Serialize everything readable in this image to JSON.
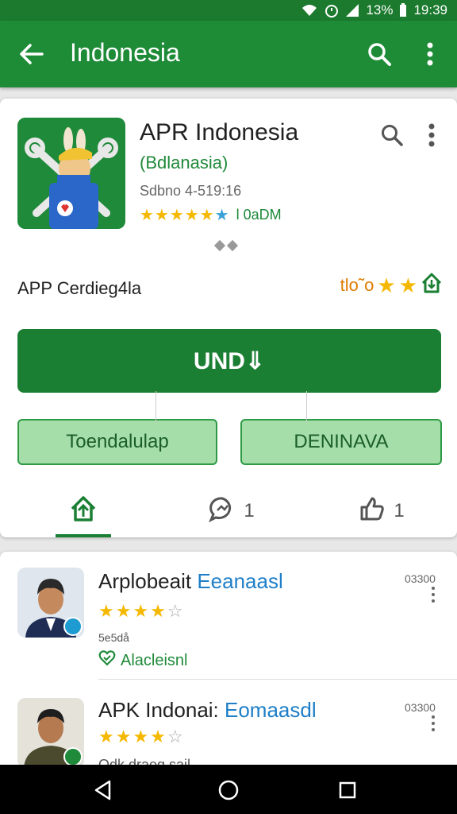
{
  "status_bar": {
    "battery": "13%",
    "time": "19:39"
  },
  "app_bar": {
    "title": "Indonesia"
  },
  "app": {
    "name": "APR Indonesia",
    "developer": "(Bdlanasia)",
    "meta": "Sdbno 4-519:16",
    "rating_count": "l 0aDM",
    "category": "APP Cerdieg4la",
    "category_rating_text": "tlo˜o"
  },
  "buttons": {
    "install": "UND⇓",
    "secondary_left": "Toendalulap",
    "secondary_right": "DENINAVA"
  },
  "tabs": [
    {
      "label": ""
    },
    {
      "label": "1"
    },
    {
      "label": "1"
    }
  ],
  "list": [
    {
      "title_prefix": "Arplobeait ",
      "title_highlight": "Eeanaasl",
      "subline": "5e5då",
      "tag": "Alacleisnl",
      "meta": "03300"
    },
    {
      "title_prefix": "APK Indonai: ",
      "title_highlight": "Eomaasdl",
      "subline": "Odk draeg sail",
      "tag": "",
      "meta": "03300"
    }
  ],
  "colors": {
    "primary": "#1e8b37",
    "accent_light": "#a6deaa",
    "star": "#f5b800",
    "link": "#1e7fc8"
  }
}
